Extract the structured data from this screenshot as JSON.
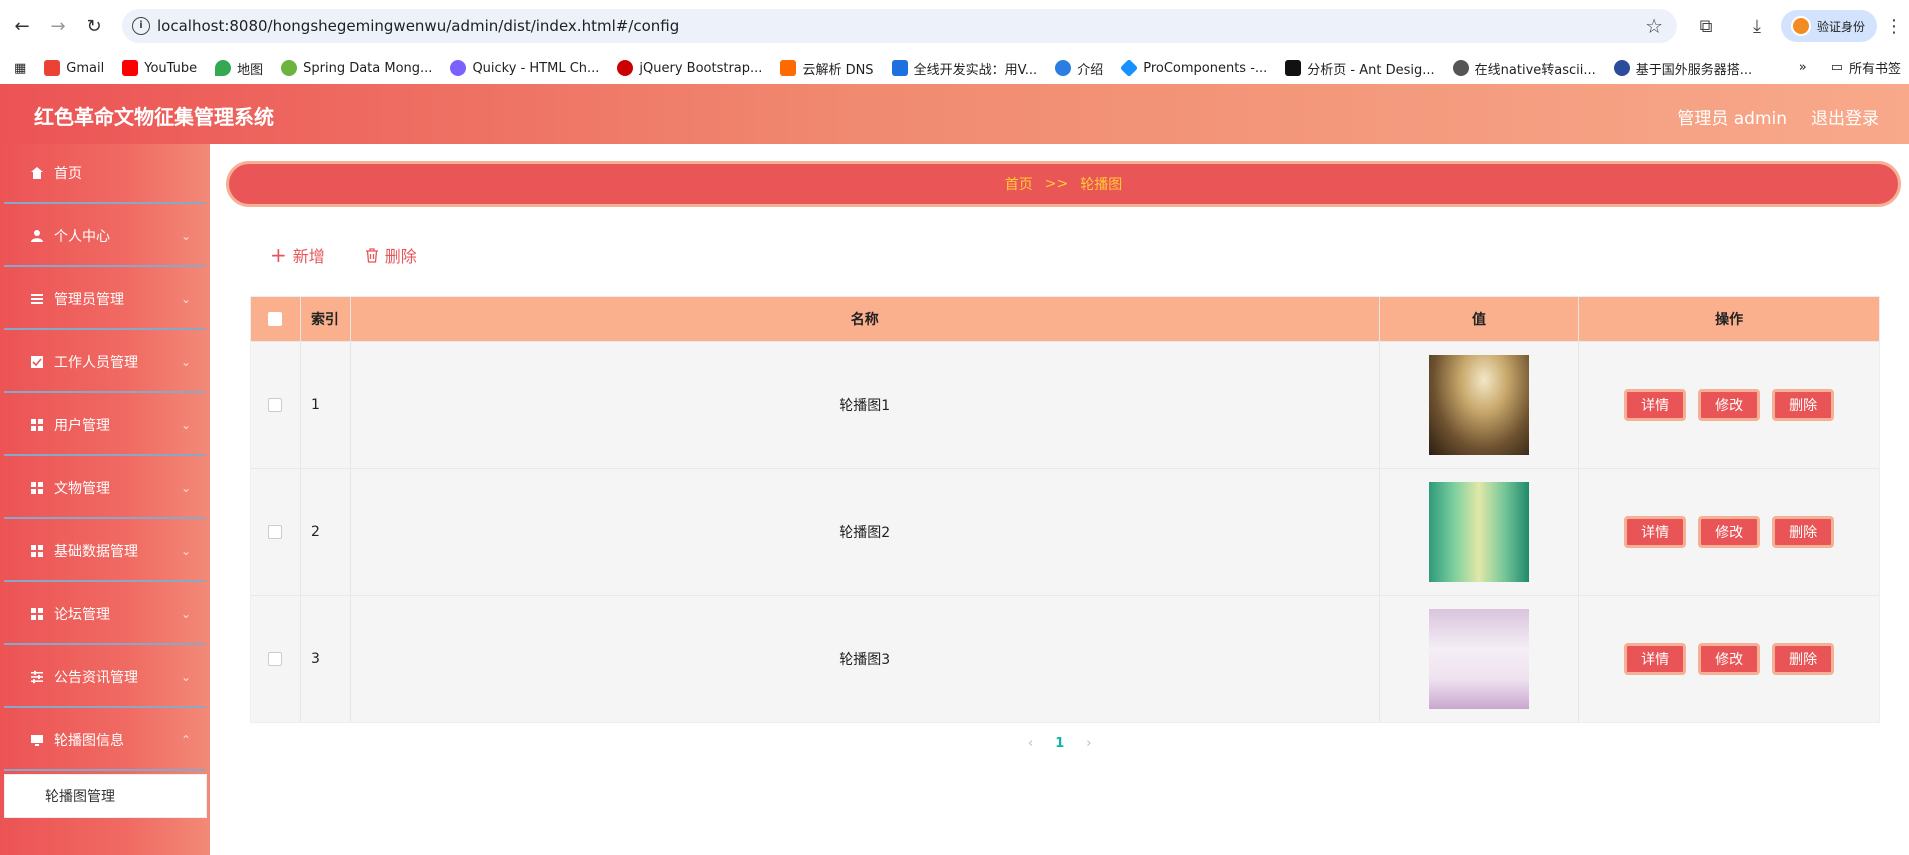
{
  "browser": {
    "url": "localhost:8080/hongshegemingwenwu/admin/dist/index.html#/config",
    "profile_label": "验证身份",
    "bookmarks": [
      "Gmail",
      "YouTube",
      "地图",
      "Spring Data Mong...",
      "Quicky - HTML Ch...",
      "jQuery Bootstrap...",
      "云解析 DNS",
      "全线开发实战：用V...",
      "介绍",
      "ProComponents -...",
      "分析页 - Ant Desig...",
      "在线native转ascii...",
      "基于国外服务器搭..."
    ],
    "all_bookmarks_label": "所有书签",
    "more_label": "»"
  },
  "header": {
    "title": "红色革命文物征集管理系统",
    "user_label": "管理员 admin",
    "logout_label": "退出登录"
  },
  "sidebar": {
    "items": [
      {
        "label": "首页",
        "icon": "home-icon"
      },
      {
        "label": "个人中心",
        "icon": "user-icon"
      },
      {
        "label": "管理员管理",
        "icon": "list-icon"
      },
      {
        "label": "工作人员管理",
        "icon": "checkbox-icon"
      },
      {
        "label": "用户管理",
        "icon": "grid-icon"
      },
      {
        "label": "文物管理",
        "icon": "grid-icon"
      },
      {
        "label": "基础数据管理",
        "icon": "grid-icon"
      },
      {
        "label": "论坛管理",
        "icon": "grid-icon"
      },
      {
        "label": "公告资讯管理",
        "icon": "sliders-icon"
      },
      {
        "label": "轮播图信息",
        "icon": "monitor-icon"
      }
    ],
    "sub_item": "轮播图管理"
  },
  "breadcrumb": {
    "home": "首页",
    "separator": ">>",
    "current": "轮播图"
  },
  "actions": {
    "add_label": "新增",
    "delete_label": "删除"
  },
  "table": {
    "columns": [
      "索引",
      "名称",
      "值",
      "操作"
    ],
    "rows": [
      {
        "index": "1",
        "name": "轮播图1"
      },
      {
        "index": "2",
        "name": "轮播图2"
      },
      {
        "index": "3",
        "name": "轮播图3"
      }
    ],
    "row_actions": [
      "详情",
      "修改",
      "删除"
    ]
  },
  "pagination": {
    "prev": "‹",
    "current_page": "1",
    "next": "›"
  },
  "colors": {
    "header_start": "#ec5355",
    "header_end": "#f8a98a",
    "table_header": "#fbb08d",
    "button": "#e95456",
    "breadcrumb_text": "#ffcc33"
  }
}
